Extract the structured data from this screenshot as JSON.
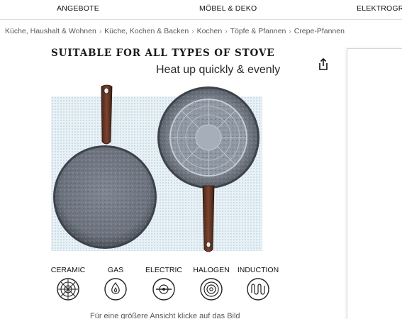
{
  "nav": {
    "items": [
      "ANGEBOTE",
      "MÖBEL & DEKO",
      "ELEKTROGRO"
    ]
  },
  "breadcrumb": [
    "Küche, Haushalt & Wohnen",
    "Küche, Kochen & Backen",
    "Kochen",
    "Töpfe & Pfannen",
    "Crepe-Pfannen"
  ],
  "product_image": {
    "headline": "SUITABLE FOR ALL TYPES OF STOVE",
    "subline": "Heat up quickly & evenly",
    "stoves": [
      "CERAMIC",
      "GAS",
      "ELECTRIC",
      "HALOGEN",
      "INDUCTION"
    ]
  },
  "hint": "Für eine größere Ansicht klicke auf das Bild",
  "icons": {
    "share": "share-icon"
  },
  "colors": {
    "pan_stone": "#8d929c",
    "handle_wood": "#6b3b26",
    "backdrop_dots": "#cfe0ea"
  }
}
